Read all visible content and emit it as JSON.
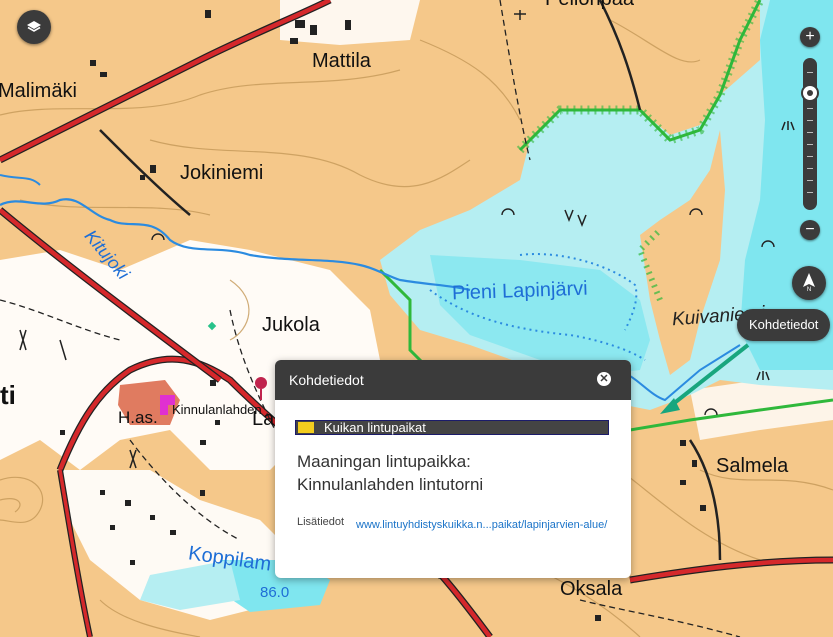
{
  "map": {
    "place_labels": {
      "mattila": "Mattila",
      "malimaki": "Malimäki",
      "jokiniemi": "Jokiniemi",
      "jukola": "Jukola",
      "salmela": "Salmela",
      "oksala": "Oksala",
      "pellonpaa": "Pellonpää",
      "hkas": "H.as.",
      "lahdenlab": "Kinnulanlahden",
      "la": "La",
      "ti": "ti"
    },
    "water_labels": {
      "lake": "Pieni Lapinjärvi",
      "river": "Kitujoki",
      "koppila": "Koppilam"
    },
    "terrain_labels": {
      "kuivaniemi": "Kuivaniemi"
    },
    "elevation": "86.0",
    "colors": {
      "land": "#f5c88a",
      "water": "#b5eef2",
      "lake_open": "#7fe6ef",
      "field": "#ffffff",
      "road": "#d5282b",
      "protected_area": "#2fb83b",
      "arrow": "#18a67e"
    }
  },
  "controls": {
    "layers_icon": "layers-icon",
    "zoom_in": "+",
    "zoom_out": "−",
    "compass_label": "N"
  },
  "tooltip": {
    "label": "Kohdetiedot"
  },
  "popup": {
    "header": "Kohdetiedot",
    "close": "✕",
    "layer_name": "Kuikan lintupaikat",
    "layer_color": "#f2cc1e",
    "title_line1": "Maaningan lintupaikka:",
    "title_line2": "Kinnulanlahden lintutorni",
    "moreinfo_label": "Lisätiedot",
    "moreinfo_link": "www.lintuyhdistyskuikka.n...paikat/lapinjarvien-alue/"
  }
}
